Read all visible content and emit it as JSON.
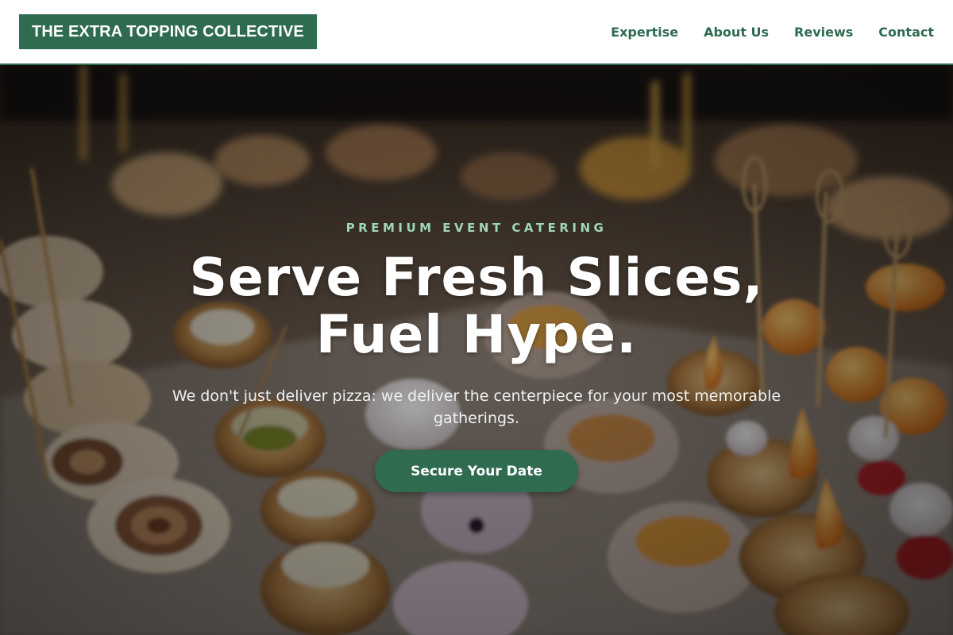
{
  "brand": {
    "name": "THE EXTRA TOPPING COLLECTIVE"
  },
  "nav": {
    "items": [
      "Expertise",
      "About Us",
      "Reviews",
      "Contact"
    ]
  },
  "hero": {
    "eyebrow": "PREMIUM EVENT CATERING",
    "headline_line1": "Serve Fresh Slices,",
    "headline_line2": "Fuel Hype.",
    "subtext": "We don't just deliver pizza: we deliver the centerpiece for your most memorable gatherings.",
    "cta_label": "Secure Your Date",
    "background": "blurred catering buffet of tartlets, pinwheel wraps and skewered desserts"
  },
  "colors": {
    "brand_green": "#2e6b4f",
    "eyebrow_green": "#9fd8b6",
    "header_bg": "#ffffff"
  }
}
